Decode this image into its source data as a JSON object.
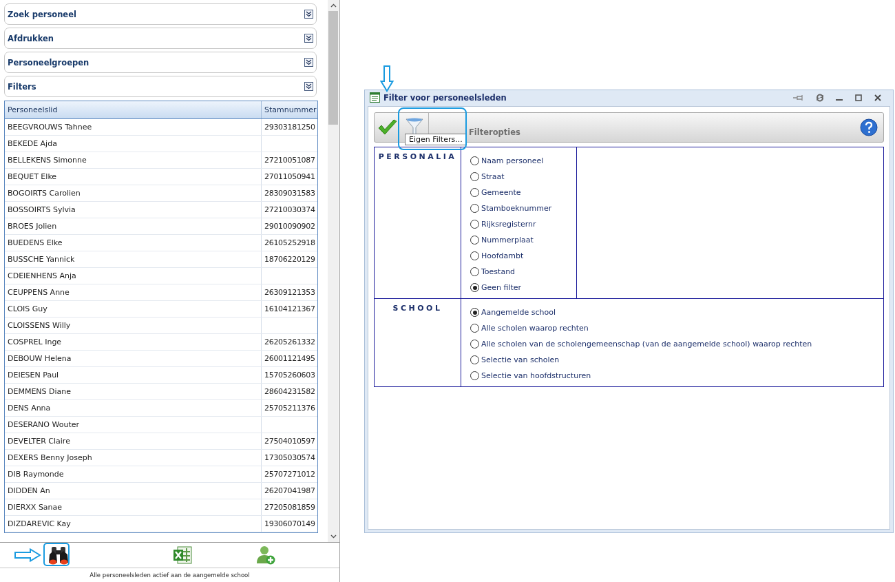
{
  "sidebar": {
    "panels": [
      {
        "title": "Zoek personeel",
        "expanded": false
      },
      {
        "title": "Afdrukken",
        "expanded": false
      },
      {
        "title": "Personeelgroepen",
        "expanded": false
      },
      {
        "title": "Filters",
        "expanded": false
      }
    ],
    "table": {
      "columns": [
        "Personeelslid",
        "Stamnummer"
      ],
      "rows": [
        [
          "BEEGVROUWS Tahnee",
          "29303181250"
        ],
        [
          "BEKEDE Ajda",
          ""
        ],
        [
          "BELLEKENS Simonne",
          "27210051087"
        ],
        [
          "BEQUET Elke",
          "27011050941"
        ],
        [
          "BOGOIRTS Carolien",
          "28309031583"
        ],
        [
          "BOSSOIRTS Sylvia",
          "27210030374"
        ],
        [
          "BROES Jolien",
          "29010090902"
        ],
        [
          "BUEDENS Elke",
          "26105252918"
        ],
        [
          "BUSSCHE Yannick",
          "18706220129"
        ],
        [
          "CDEIENHENS Anja",
          ""
        ],
        [
          "CEUPPENS Anne",
          "26309121353"
        ],
        [
          "CLOIS Guy",
          "16104121367"
        ],
        [
          "CLOISSENS Willy",
          ""
        ],
        [
          "COSPREL Inge",
          "26205261332"
        ],
        [
          "DEBOUW Helena",
          "26001121495"
        ],
        [
          "DEIESEN Paul",
          "15705260603"
        ],
        [
          "DEMMENS Diane",
          "28604231582"
        ],
        [
          "DENS Anna",
          "25705211376"
        ],
        [
          "DESERANO Wouter",
          ""
        ],
        [
          "DEVELTER Claire",
          "27504010597"
        ],
        [
          "DEXERS Benny Joseph",
          "17305030574"
        ],
        [
          "DIB Raymonde",
          "25707271012"
        ],
        [
          "DIDDEN An",
          "26207041987"
        ],
        [
          "DIERXX Sanae",
          "27205081859"
        ],
        [
          "DIZDAREVIC Kay",
          "19306070149"
        ]
      ]
    },
    "status_text": "Alle personeelsleden actief aan de aangemelde school"
  },
  "dialog": {
    "title": "Filter voor personeelsleden",
    "toolbar_label": "Filteropties",
    "tooltip": "Eigen Filters...",
    "sections": [
      {
        "heading": "PERSONALIA",
        "options": [
          {
            "label": "Naam personeel",
            "selected": false
          },
          {
            "label": "Straat",
            "selected": false
          },
          {
            "label": "Gemeente",
            "selected": false
          },
          {
            "label": "Stamboeknummer",
            "selected": false
          },
          {
            "label": "Rijksregisternr",
            "selected": false
          },
          {
            "label": "Nummerplaat",
            "selected": false
          },
          {
            "label": "Hoofdambt",
            "selected": false
          },
          {
            "label": "Toestand",
            "selected": false
          },
          {
            "label": "Geen filter",
            "selected": true
          }
        ]
      },
      {
        "heading": "SCHOOL",
        "options": [
          {
            "label": "Aangemelde school",
            "selected": true
          },
          {
            "label": "Alle scholen waarop rechten",
            "selected": false
          },
          {
            "label": "Alle scholen van de scholengemeenschap (van de aangemelde school) waarop rechten",
            "selected": false
          },
          {
            "label": "Selectie van scholen",
            "selected": false
          },
          {
            "label": "Selectie van hoofdstructuren",
            "selected": false
          }
        ]
      }
    ]
  }
}
